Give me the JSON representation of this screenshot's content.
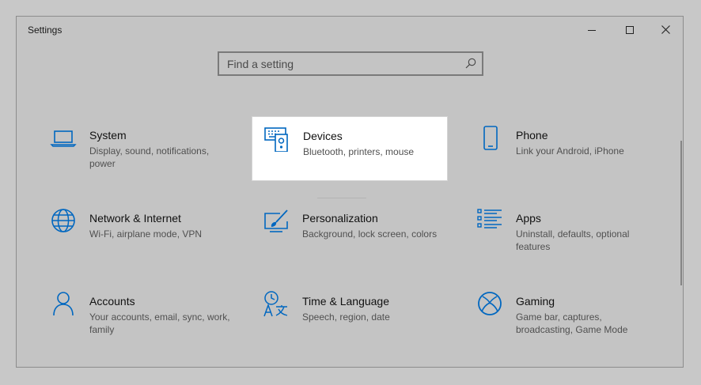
{
  "window": {
    "title": "Settings",
    "controls": {
      "minimize": "minimize",
      "maximize": "maximize",
      "close": "close"
    }
  },
  "search": {
    "placeholder": "Find a setting",
    "value": ""
  },
  "colors": {
    "accent": "#0067c0",
    "window_bg": "#c4c4c4",
    "highlight_bg": "#ffffff"
  },
  "categories": [
    {
      "title": "System",
      "description": "Display, sound, notifications, power",
      "icon": "laptop-icon"
    },
    {
      "title": "Devices",
      "description": "Bluetooth, printers, mouse",
      "icon": "devices-icon",
      "highlighted": true
    },
    {
      "title": "Phone",
      "description": "Link your Android, iPhone",
      "icon": "phone-icon"
    },
    {
      "title": "Network & Internet",
      "description": "Wi-Fi, airplane mode, VPN",
      "icon": "globe-icon"
    },
    {
      "title": "Personalization",
      "description": "Background, lock screen, colors",
      "icon": "personalization-icon"
    },
    {
      "title": "Apps",
      "description": "Uninstall, defaults, optional features",
      "icon": "apps-list-icon"
    },
    {
      "title": "Accounts",
      "description": "Your accounts, email, sync, work, family",
      "icon": "person-icon"
    },
    {
      "title": "Time & Language",
      "description": "Speech, region, date",
      "icon": "time-language-icon"
    },
    {
      "title": "Gaming",
      "description": "Game bar, captures, broadcasting, Game Mode",
      "icon": "xbox-icon"
    }
  ]
}
